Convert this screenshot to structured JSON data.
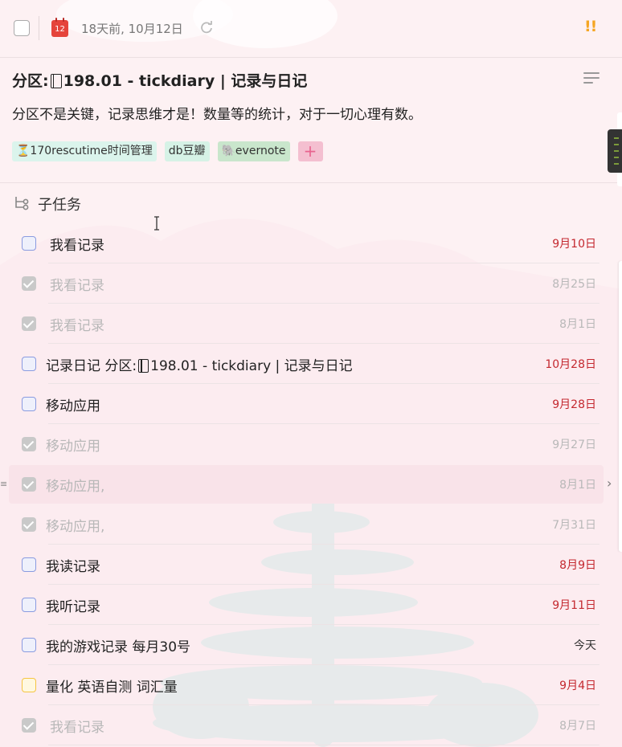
{
  "header": {
    "date_text": "18天前, 10月12日",
    "calendar_day": "12",
    "priority": "!!"
  },
  "task": {
    "title_prefix": "分区:",
    "title_suffix": "198.01 - tickdiary | 记录与日记",
    "description": "分区不是关键，记录思维才是！数量等的统计，对于一切心理有数。",
    "tags": [
      {
        "label": "⏳170rescutime时间管理"
      },
      {
        "label": "db豆瓣"
      },
      {
        "label": "🐘evernote"
      }
    ],
    "add_tag": "+"
  },
  "subtasks": {
    "header": "子任务",
    "items": [
      {
        "label": "我看记录",
        "date": "9月10日",
        "done": false,
        "status": "overdue"
      },
      {
        "label": "我看记录",
        "date": "8月25日",
        "done": true,
        "status": "done"
      },
      {
        "label": "我看记录",
        "date": "8月1日",
        "done": true,
        "status": "done"
      },
      {
        "label_prefix": "记录日记 分区:",
        "label_suffix": "198.01 - tickdiary | 记录与日记",
        "date": "10月28日",
        "done": false,
        "status": "overdue"
      },
      {
        "label": "移动应用",
        "date": "9月28日",
        "done": false,
        "status": "overdue"
      },
      {
        "label": "移动应用",
        "date": "9月27日",
        "done": true,
        "status": "done"
      },
      {
        "label": "移动应用,",
        "date": "8月1日",
        "done": true,
        "status": "done"
      },
      {
        "label": "移动应用,",
        "date": "7月31日",
        "done": true,
        "status": "done"
      },
      {
        "label": "我读记录",
        "date": "8月9日",
        "done": false,
        "status": "overdue"
      },
      {
        "label": "我听记录",
        "date": "9月11日",
        "done": false,
        "status": "overdue"
      },
      {
        "label": "我的游戏记录 每月30号",
        "date": "今天",
        "done": false,
        "status": "today"
      },
      {
        "label": "量化 英语自测 词汇量",
        "date": "9月4日",
        "done": false,
        "status": "overdue"
      },
      {
        "label": "我看记录",
        "date": "8月7日",
        "done": true,
        "status": "done"
      }
    ]
  },
  "colors": {
    "overdue": "#c4282f",
    "done": "#b8b8b8",
    "priority": "#f5a623",
    "accent_pink": "#e8648f"
  }
}
